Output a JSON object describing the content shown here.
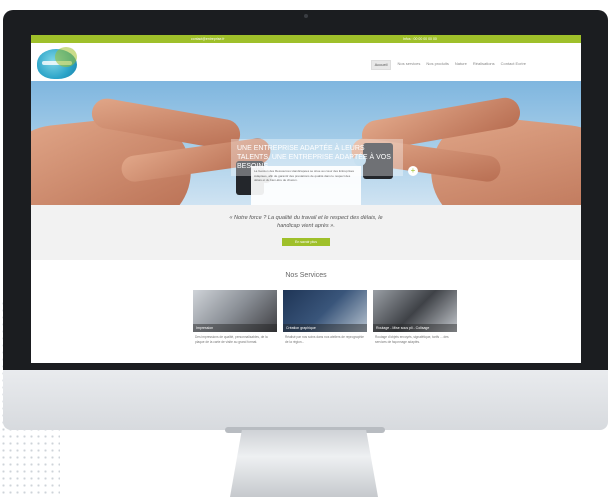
{
  "website": {
    "topbar": {
      "left_text": "contact@entreprise.fr",
      "right_text": "Infos : 00 00 00 00 00"
    },
    "nav": {
      "items": [
        {
          "label": "Accueil",
          "active": true
        },
        {
          "label": "Nos services",
          "active": false
        },
        {
          "label": "Nos produits",
          "active": false
        },
        {
          "label": "Nature",
          "active": false
        },
        {
          "label": "Réalisations",
          "active": false
        },
        {
          "label": "Contact Ecrire",
          "active": false
        }
      ]
    },
    "hero": {
      "title": "UNE ENTREPRISE ADAPTÉE À LEURS TALENTS, UNE ENTREPRISE ADAPTÉE À VOS BESOINS",
      "body": "La Gestion des Ressources Handicapées se situe au cœur des Entreprises Adaptées, afin de garantir des prestations de qualité dans le respect des délais et du bien-être de chacun.",
      "plus": "+"
    },
    "quote": {
      "text": "« Notre force ? La qualité du travail et le respect des délais, le handicap vient après ».",
      "cta": "En savoir plus"
    },
    "services": {
      "title": "Nos Services",
      "cards": [
        {
          "caption": "Impression",
          "text": "Des impressions de qualité, personnalisables, de la plaque de la carte de visite au grand format."
        },
        {
          "caption": "Création graphique",
          "text": "Réalisé par nos soins dans nos ateliers de reprographie de la région..."
        },
        {
          "caption": "Routage - Mise sous pli - Colisage",
          "text": "Routage d'objets envoyés, signalétique, tarifs ... des services de façonnage adaptés."
        }
      ]
    }
  },
  "colors": {
    "accent": "#9fc02a",
    "bezel": "#1b1d20"
  }
}
